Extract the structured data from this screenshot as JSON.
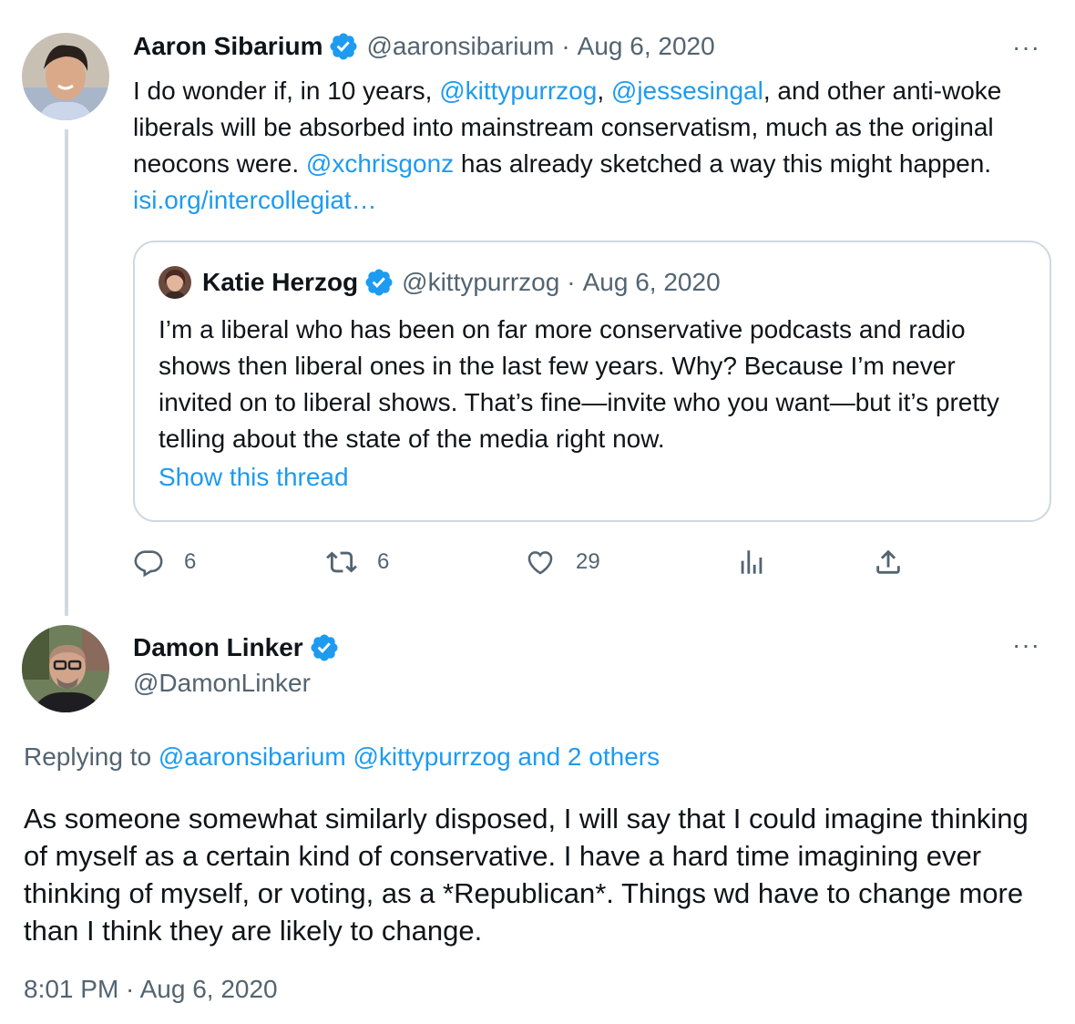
{
  "tweet1": {
    "author_name": "Aaron Sibarium",
    "author_handle": "@aaronsibarium",
    "separator": "·",
    "date": "Aug 6, 2020",
    "more_label": "···",
    "text": {
      "p1": "I do wonder if, in 10 years, ",
      "m1": "@kittypurrzog",
      "p2": ", ",
      "m2": "@jessesingal",
      "p3": ", and other anti-woke liberals will be absorbed into mainstream conservatism, much as the original neocons were. ",
      "m3": "@xchrisgonz",
      "p4": " has already sketched a way this might happen. ",
      "url": "isi.org/intercollegiat…"
    },
    "quote": {
      "author_name": "Katie Herzog",
      "author_handle": "@kittypurrzog",
      "separator": "·",
      "date": "Aug 6, 2020",
      "text": "I’m a liberal who has been on far more conservative podcasts and radio shows then liberal ones in the last few years. Why? Because I’m never invited on to liberal shows. That’s fine—invite who you want—but it’s pretty telling about the state of the media right now.",
      "show_thread": "Show this thread"
    },
    "actions": {
      "reply_count": "6",
      "retweet_count": "6",
      "like_count": "29"
    }
  },
  "tweet2": {
    "author_name": "Damon Linker",
    "author_handle": "@DamonLinker",
    "more_label": "···",
    "replying_prefix": "Replying to ",
    "replying_to": "@aaronsibarium @kittypurrzog and 2 others",
    "text": "As someone somewhat similarly disposed, I will say that I could imagine thinking of myself as a certain kind of conservative. I have a hard time imagining ever thinking of myself, or voting, as a *Republican*. Things wd have to change more than I think they are likely to change.",
    "timestamp": "8:01 PM · Aug 6, 2020"
  },
  "colors": {
    "accent": "#1d9bf0",
    "muted": "#536471",
    "border": "#cfd9de",
    "text": "#0f1419"
  },
  "icons": [
    "verified-badge-icon",
    "more-icon",
    "reply-icon",
    "retweet-icon",
    "like-icon",
    "views-icon",
    "share-icon"
  ]
}
